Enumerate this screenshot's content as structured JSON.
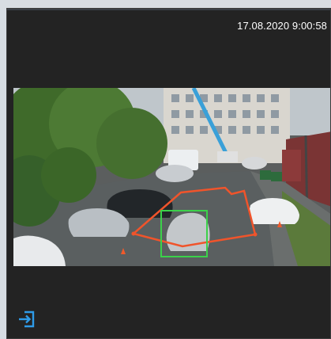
{
  "camera_tile": {
    "timestamp": "17.08.2020 9:00:58",
    "zone_color": "#f0542b",
    "detection_color": "#3bd14a",
    "exit_icon": "sign-in-icon",
    "exit_icon_color": "#2e9be8"
  }
}
